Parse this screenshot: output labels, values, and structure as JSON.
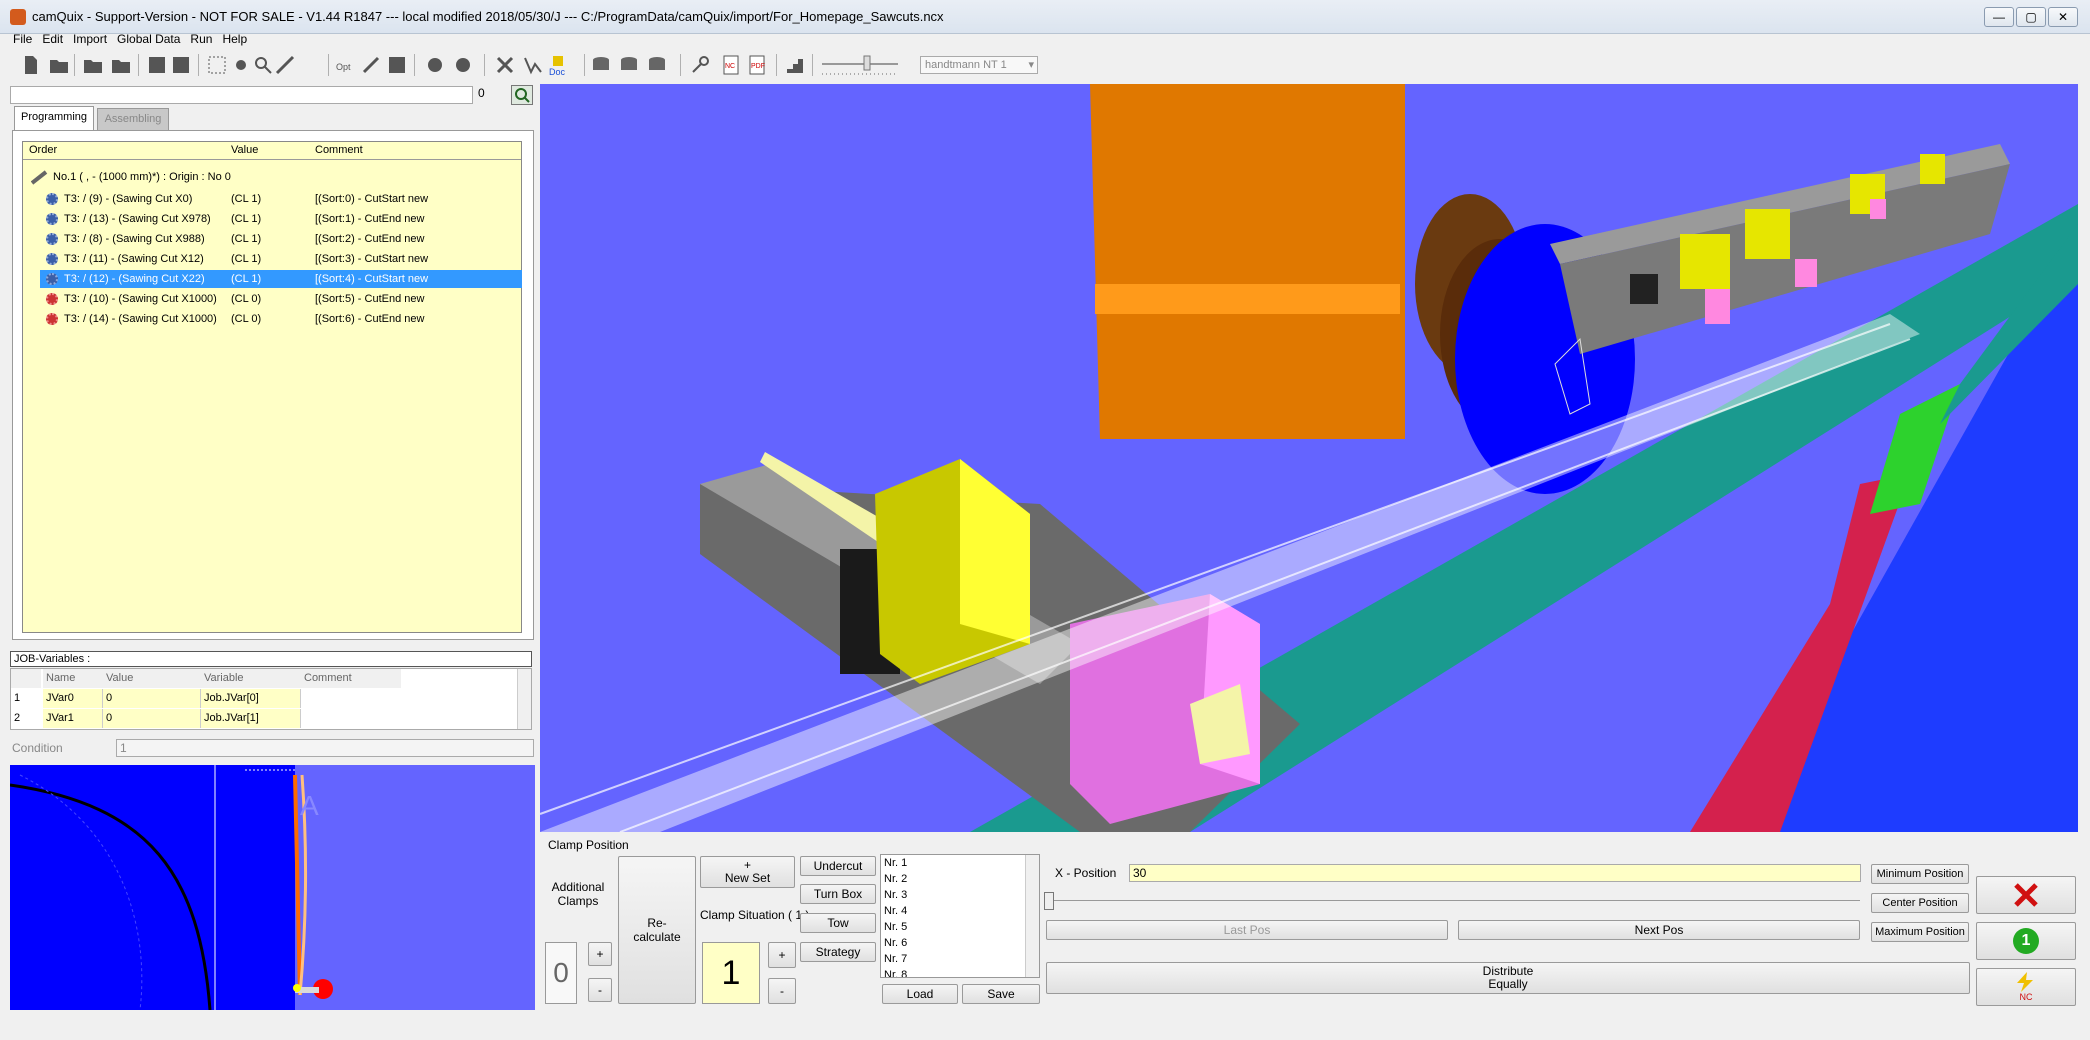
{
  "window": {
    "title": "camQuix - Support-Version - NOT FOR SALE - V1.44 R1847  --- local modified 2018/05/30/J ---  C:/ProgramData/camQuix/import/For_Homepage_Sawcuts.ncx",
    "minimize": "—",
    "maximize": "▢",
    "close": "✕"
  },
  "menu": [
    "File",
    "Edit",
    "Import",
    "Global Data",
    "Run",
    "Help"
  ],
  "toolbar": {
    "machine_select": "handtmann NT 1"
  },
  "search": {
    "value": "",
    "count": "0"
  },
  "tabs": [
    {
      "label": "Programming"
    },
    {
      "label": "Assembling"
    }
  ],
  "tree": {
    "headers": {
      "order": "Order",
      "value": "Value",
      "comment": "Comment"
    },
    "root": "No.1 ( , - (1000 mm)*) :  Origin : No 0",
    "rows": [
      {
        "order": "T3: / (9) - (Sawing Cut X0)",
        "value": "(CL 1)",
        "comment": "[(Sort:0) - CutStart new"
      },
      {
        "order": "T3: / (13) - (Sawing Cut X978)",
        "value": "(CL 1)",
        "comment": "[(Sort:1) - CutEnd new"
      },
      {
        "order": "T3: / (8) - (Sawing Cut X988)",
        "value": "(CL 1)",
        "comment": "[(Sort:2) - CutEnd new"
      },
      {
        "order": "T3: / (11) - (Sawing Cut X12)",
        "value": "(CL 1)",
        "comment": "[(Sort:3) - CutStart new"
      },
      {
        "order": "T3: / (12) - (Sawing Cut X22)",
        "value": "(CL 1)",
        "comment": "[(Sort:4) - CutStart new"
      },
      {
        "order": "T3: / (10) - (Sawing Cut X1000)",
        "value": "(CL 0)",
        "comment": "[(Sort:5) - CutEnd new"
      },
      {
        "order": "T3: / (14) - (Sawing Cut X1000)",
        "value": "(CL 0)",
        "comment": "[(Sort:6) - CutEnd new"
      }
    ]
  },
  "job_variables": {
    "title": "JOB-Variables :",
    "headers": {
      "name": "Name",
      "value": "Value",
      "variable": "Variable",
      "comment": "Comment"
    },
    "rows": [
      {
        "n": "1",
        "name": "JVar0",
        "value": "0",
        "variable": "Job.JVar[0]",
        "comment": ""
      },
      {
        "n": "2",
        "name": "JVar1",
        "value": "0",
        "variable": "Job.JVar[1]",
        "comment": ""
      }
    ]
  },
  "condition": {
    "label": "Condition",
    "value": "1"
  },
  "clamp": {
    "title": "Clamp Position",
    "additional_clamps": "Additional\nClamps",
    "additional_count": "0",
    "plus": "+",
    "minus": "-",
    "recalculate": "Re-\ncalculate",
    "new_set": "+\nNew Set",
    "situation_label": "Clamp Situation ( 1 )",
    "situation_value": "1",
    "undercut": "Undercut",
    "turn_box": "Turn Box",
    "tow": "Tow",
    "strategy": "Strategy",
    "list": [
      "Nr. 1",
      "Nr. 2",
      "Nr. 3",
      "Nr. 4",
      "Nr. 5",
      "Nr. 6",
      "Nr. 7",
      "Nr. 8"
    ],
    "load": "Load",
    "save": "Save",
    "x_label": "X - Position",
    "x_value": "30",
    "last_pos": "Last Pos",
    "next_pos": "Next Pos",
    "distribute": "Distribute\nEqually",
    "min_pos": "Minimum Position",
    "center_pos": "Center Position",
    "max_pos": "Maximum Position",
    "ok_badge": "1",
    "nc_label": "NC"
  },
  "colors": {
    "selection": "#3399ff",
    "tree_bg": "#ffffc6",
    "view_bg": "#6464ff",
    "preview_bg": "#0000ff"
  }
}
